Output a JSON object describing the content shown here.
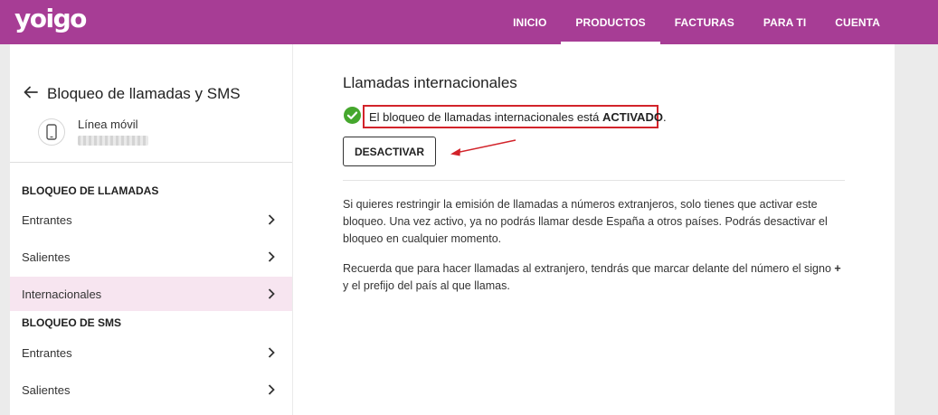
{
  "header": {
    "logo": "yoigo",
    "nav": [
      {
        "label": "INICIO"
      },
      {
        "label": "PRODUCTOS",
        "active": true
      },
      {
        "label": "FACTURAS"
      },
      {
        "label": "PARA TI"
      },
      {
        "label": "CUENTA"
      }
    ],
    "color": "#a73d95"
  },
  "sidebar": {
    "title": "Bloqueo de llamadas y SMS",
    "back_icon": "arrow-left-icon",
    "line_label": "Línea móvil",
    "line_icon": "mobile-phone-icon",
    "sections": [
      {
        "title": "BLOQUEO DE LLAMADAS",
        "items": [
          {
            "label": "Entrantes"
          },
          {
            "label": "Salientes"
          },
          {
            "label": "Internacionales",
            "active": true
          }
        ]
      },
      {
        "title": "BLOQUEO DE SMS",
        "items": [
          {
            "label": "Entrantes"
          },
          {
            "label": "Salientes"
          }
        ]
      }
    ],
    "active_color": "#f7e5f0"
  },
  "main": {
    "title": "Llamadas internacionales",
    "status_prefix": "El bloqueo de llamadas internacionales está ",
    "status_value": "ACTIVADO",
    "status_suffix": ".",
    "status_icon": "check-circle-icon",
    "status_color": "#45a72d",
    "annotation_color": "#d2232a",
    "button_label": "DESACTIVAR",
    "paragraph1": "Si quieres restringir la emisión de llamadas a números extranjeros, solo tienes que activar este bloqueo. Una vez activo, ya no podrás llamar desde España a otros países. Podrás desactivar el bloqueo en cualquier momento.",
    "paragraph2_prefix": "Recuerda que para hacer llamadas al extranjero, tendrás que marcar delante del número el signo ",
    "paragraph2_bold": "+",
    "paragraph2_suffix": " y el prefijo del país al que llamas."
  }
}
